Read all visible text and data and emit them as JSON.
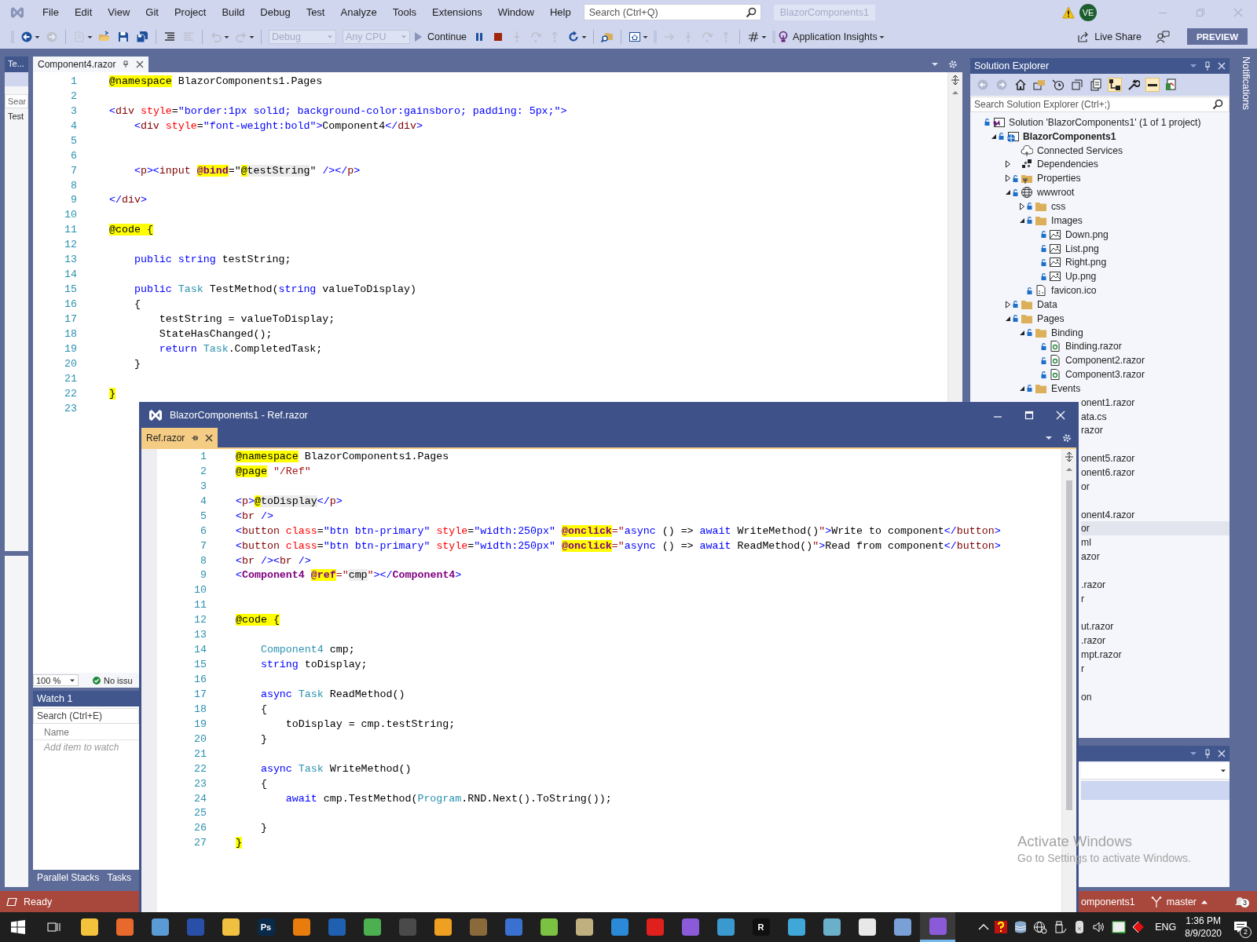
{
  "menu": [
    "File",
    "Edit",
    "View",
    "Git",
    "Project",
    "Build",
    "Debug",
    "Test",
    "Analyze",
    "Tools",
    "Extensions",
    "Window",
    "Help"
  ],
  "search": {
    "placeholder": "Search (Ctrl+Q)"
  },
  "solution_name": "BlazorComponents1",
  "account": {
    "initials": "VE"
  },
  "toolbar": [
    {
      "kind": "grip"
    },
    {
      "kind": "back",
      "disabled": false
    },
    {
      "kind": "caret",
      "disabled": false
    },
    {
      "kind": "forward",
      "disabled": true
    },
    {
      "kind": "sep"
    },
    {
      "kind": "new",
      "disabled": true
    },
    {
      "kind": "caret",
      "disabled": false
    },
    {
      "kind": "open",
      "disabled": false
    },
    {
      "kind": "save",
      "disabled": false
    },
    {
      "kind": "saveall",
      "disabled": false
    },
    {
      "kind": "sep"
    },
    {
      "kind": "comment",
      "disabled": false
    },
    {
      "kind": "uncomment",
      "disabled": true
    },
    {
      "kind": "sep"
    },
    {
      "kind": "undo",
      "disabled": true
    },
    {
      "kind": "caret",
      "disabled": false
    },
    {
      "kind": "redo",
      "disabled": true
    },
    {
      "kind": "caret",
      "disabled": false
    },
    {
      "kind": "sep"
    },
    {
      "kind": "combo",
      "label": "Debug",
      "disabled": true
    },
    {
      "kind": "combo",
      "label": "Any CPU",
      "disabled": true
    },
    {
      "kind": "continue",
      "label": "Continue",
      "disabled": false
    },
    {
      "kind": "pause",
      "disabled": false
    },
    {
      "kind": "stop",
      "disabled": false
    },
    {
      "kind": "stepinto",
      "disabled": true
    },
    {
      "kind": "stepover",
      "disabled": true
    },
    {
      "kind": "stepout",
      "disabled": true
    },
    {
      "kind": "restart",
      "disabled": false
    },
    {
      "kind": "caret",
      "disabled": false
    },
    {
      "kind": "sep"
    },
    {
      "kind": "find",
      "disabled": false
    },
    {
      "kind": "sep"
    },
    {
      "kind": "screen",
      "disabled": false
    },
    {
      "kind": "caret",
      "disabled": false
    },
    {
      "kind": "grip"
    },
    {
      "kind": "forward_arrow",
      "disabled": true
    },
    {
      "kind": "stepinto",
      "disabled": true
    },
    {
      "kind": "stepover",
      "disabled": true
    },
    {
      "kind": "stepout",
      "disabled": true
    },
    {
      "kind": "sep"
    },
    {
      "kind": "hash",
      "disabled": false
    },
    {
      "kind": "caret",
      "disabled": false
    },
    {
      "kind": "grip"
    },
    {
      "kind": "insights",
      "label": "Application Insights",
      "disabled": false
    },
    {
      "kind": "caret",
      "disabled": false
    }
  ],
  "live_share": "Live Share",
  "preview": "PREVIEW",
  "left_panel": {
    "tab": "Te...",
    "search": "Sear",
    "item": "Test"
  },
  "editor": {
    "tab": {
      "label": "Component4.razor",
      "selected": true
    },
    "zoom": "100 %",
    "issues": "No issu",
    "lines": [
      {
        "n": "1",
        "tokens": [
          {
            "kind": "dir",
            "text": "@namespace"
          },
          {
            "kind": "p",
            "text": " BlazorComponents1.Pages"
          }
        ]
      },
      {
        "n": "2"
      },
      {
        "n": "3",
        "tokens": [
          {
            "kind": "tagd",
            "text": "<"
          },
          {
            "kind": "tagn",
            "text": "div"
          },
          {
            "kind": "attr",
            "text": " style"
          },
          {
            "kind": "p",
            "text": "="
          },
          {
            "kind": "val",
            "text": "\"border:1px solid; background-color:gainsboro; padding: 5px;\""
          },
          {
            "kind": "tagd",
            "text": ">"
          }
        ]
      },
      {
        "n": "4",
        "tokens": [
          {
            "kind": "tagd",
            "text": "    <"
          },
          {
            "kind": "tagn",
            "text": "div"
          },
          {
            "kind": "attr",
            "text": " style"
          },
          {
            "kind": "p",
            "text": "="
          },
          {
            "kind": "val",
            "text": "\"font-weight:bold\""
          },
          {
            "kind": "tagd",
            "text": ">"
          },
          {
            "kind": "p",
            "text": "Component4"
          },
          {
            "kind": "tagd",
            "text": "</"
          },
          {
            "kind": "tagn",
            "text": "div"
          },
          {
            "kind": "tagd",
            "text": ">"
          }
        ]
      },
      {
        "n": "5"
      },
      {
        "n": "6"
      },
      {
        "n": "7",
        "tokens": [
          {
            "kind": "tagd",
            "text": "    <"
          },
          {
            "kind": "tagn",
            "text": "p"
          },
          {
            "kind": "tagd",
            "text": "><"
          },
          {
            "kind": "tagn",
            "text": "input "
          },
          {
            "kind": "rattr",
            "text": "@bind"
          },
          {
            "kind": "p",
            "text": "=\""
          },
          {
            "kind": "dir",
            "text": "@"
          },
          {
            "kind": "cs",
            "text": "testString"
          },
          {
            "kind": "p",
            "text": "\" "
          },
          {
            "kind": "tagd",
            "text": "/></"
          },
          {
            "kind": "tagn",
            "text": "p"
          },
          {
            "kind": "tagd",
            "text": ">"
          }
        ]
      },
      {
        "n": "8"
      },
      {
        "n": "9",
        "tokens": [
          {
            "kind": "tagd",
            "text": "</"
          },
          {
            "kind": "tagn",
            "text": "div"
          },
          {
            "kind": "tagd",
            "text": ">"
          }
        ]
      },
      {
        "n": "10"
      },
      {
        "n": "11",
        "tokens": [
          {
            "kind": "dir",
            "text": "@code"
          },
          {
            "kind": "dir",
            "text": " {"
          }
        ]
      },
      {
        "n": "12"
      },
      {
        "n": "13",
        "tokens": [
          {
            "kind": "kw",
            "text": "    public"
          },
          {
            "kind": "kw",
            "text": " string"
          },
          {
            "kind": "p",
            "text": " testString;"
          }
        ]
      },
      {
        "n": "14"
      },
      {
        "n": "15",
        "tokens": [
          {
            "kind": "kw",
            "text": "    public"
          },
          {
            "kind": "type",
            "text": " Task"
          },
          {
            "kind": "p",
            "text": " TestMethod("
          },
          {
            "kind": "kw",
            "text": "string"
          },
          {
            "kind": "p",
            "text": " valueToDisplay)"
          }
        ]
      },
      {
        "n": "16",
        "tokens": [
          {
            "kind": "p",
            "text": "    {"
          }
        ]
      },
      {
        "n": "17",
        "tokens": [
          {
            "kind": "p",
            "text": "        testString = valueToDisplay;"
          }
        ]
      },
      {
        "n": "18",
        "tokens": [
          {
            "kind": "p",
            "text": "        StateHasChanged();"
          }
        ]
      },
      {
        "n": "19",
        "tokens": [
          {
            "kind": "kw",
            "text": "        return"
          },
          {
            "kind": "type",
            "text": " Task"
          },
          {
            "kind": "p",
            "text": ".CompletedTask;"
          }
        ]
      },
      {
        "n": "20",
        "tokens": [
          {
            "kind": "p",
            "text": "    }"
          }
        ]
      },
      {
        "n": "21"
      },
      {
        "n": "22",
        "tokens": [
          {
            "kind": "dir",
            "text": "}"
          }
        ]
      },
      {
        "n": "23"
      }
    ]
  },
  "watch": {
    "title": "Watch 1",
    "search_placeholder": "Search (Ctrl+E)",
    "column": "Name",
    "hint": "Add item to watch",
    "tabs": [
      {
        "label": "Parallel Stacks",
        "selected": false
      },
      {
        "label": "Tasks",
        "selected": false
      }
    ]
  },
  "solution_explorer": {
    "title": "Solution Explorer",
    "search_placeholder": "Search Solution Explorer (Ctrl+;)",
    "tree": [
      {
        "label": "Solution 'BlazorComponents1' (1 of 1 project)",
        "kind": "solution",
        "locked": true,
        "children": [
          {
            "label": "BlazorComponents1",
            "kind": "project",
            "locked": true,
            "expanded": true,
            "children": [
              {
                "label": "Connected Services",
                "kind": "service",
                "locked": false
              },
              {
                "label": "Dependencies",
                "kind": "deps",
                "locked": false,
                "expanded": false
              },
              {
                "label": "Properties",
                "kind": "props",
                "locked": true,
                "expanded": false
              },
              {
                "label": "wwwroot",
                "kind": "globe",
                "locked": true,
                "expanded": true,
                "children": [
                  {
                    "label": "css",
                    "kind": "folder",
                    "locked": true,
                    "expanded": false
                  },
                  {
                    "label": "Images",
                    "kind": "folder",
                    "locked": true,
                    "expanded": true,
                    "children": [
                      {
                        "label": "Down.png",
                        "kind": "image",
                        "locked": true
                      },
                      {
                        "label": "List.png",
                        "kind": "image",
                        "locked": true
                      },
                      {
                        "label": "Right.png",
                        "kind": "image",
                        "locked": true
                      },
                      {
                        "label": "Up.png",
                        "kind": "image",
                        "locked": true
                      }
                    ]
                  },
                  {
                    "label": "favicon.ico",
                    "kind": "file",
                    "locked": true
                  }
                ]
              },
              {
                "label": "Data",
                "kind": "folder",
                "locked": true,
                "expanded": false
              },
              {
                "label": "Pages",
                "kind": "folder",
                "locked": true,
                "expanded": true,
                "children": [
                  {
                    "label": "Binding",
                    "kind": "folder",
                    "locked": true,
                    "expanded": true,
                    "children": [
                      {
                        "label": "Binding.razor",
                        "kind": "razor",
                        "locked": true
                      },
                      {
                        "label": "Component2.razor",
                        "kind": "razor",
                        "locked": true
                      },
                      {
                        "label": "Component3.razor",
                        "kind": "razor",
                        "locked": true
                      }
                    ]
                  },
                  {
                    "label": "Events",
                    "kind": "folder",
                    "locked": true,
                    "expanded": true
                  }
                ]
              }
            ]
          }
        ]
      }
    ],
    "covered_rows": [
      {
        "text": "onent1.razor",
        "selected": false
      },
      {
        "text": "ata.cs",
        "selected": false
      },
      {
        "text": "razor",
        "selected": false
      },
      {
        "selected": false
      },
      {
        "text": "onent5.razor",
        "selected": false
      },
      {
        "text": "onent6.razor",
        "selected": false
      },
      {
        "text": "or",
        "selected": false
      },
      {
        "selected": false
      },
      {
        "text": "onent4.razor",
        "selected": false
      },
      {
        "text": "or",
        "selected": true
      },
      {
        "text": "ml",
        "selected": false
      },
      {
        "text": "azor",
        "selected": false
      },
      {
        "selected": false
      },
      {
        "text": ".razor",
        "selected": false
      },
      {
        "text": "r",
        "selected": false
      },
      {
        "selected": false
      },
      {
        "text": "ut.razor",
        "selected": false
      },
      {
        "text": ".razor",
        "selected": false
      },
      {
        "text": "mpt.razor",
        "selected": false
      },
      {
        "text": "r",
        "selected": false
      },
      {
        "selected": false
      },
      {
        "text": "on",
        "selected": false
      }
    ]
  },
  "lower_panel": {
    "rows": [
      {
        "selected": true
      }
    ]
  },
  "notifications_tab": "Notifications",
  "floating_window": {
    "title": "BlazorComponents1 - Ref.razor",
    "tab": {
      "label": "Ref.razor",
      "selected": true
    },
    "lines": [
      {
        "n": "1",
        "tokens": [
          {
            "kind": "dir",
            "text": "@namespace"
          },
          {
            "kind": "p",
            "text": " BlazorComponents1.Pages"
          }
        ]
      },
      {
        "n": "2",
        "tokens": [
          {
            "kind": "dir",
            "text": "@page"
          },
          {
            "kind": "str",
            "text": " \"/Ref\""
          }
        ]
      },
      {
        "n": "3"
      },
      {
        "n": "4",
        "tokens": [
          {
            "kind": "tagd",
            "text": "<"
          },
          {
            "kind": "tagn",
            "text": "p"
          },
          {
            "kind": "tagd",
            "text": ">"
          },
          {
            "kind": "dir",
            "text": "@"
          },
          {
            "kind": "cs",
            "text": "toDisplay"
          },
          {
            "kind": "tagd",
            "text": "</"
          },
          {
            "kind": "tagn",
            "text": "p"
          },
          {
            "kind": "tagd",
            "text": ">"
          }
        ]
      },
      {
        "n": "5",
        "tokens": [
          {
            "kind": "tagd",
            "text": "<"
          },
          {
            "kind": "tagn",
            "text": "br"
          },
          {
            "kind": "tagd",
            "text": " />"
          }
        ]
      },
      {
        "n": "6",
        "tokens": [
          {
            "kind": "tagd",
            "text": "<"
          },
          {
            "kind": "tagn",
            "text": "button"
          },
          {
            "kind": "attr",
            "text": " class"
          },
          {
            "kind": "p",
            "text": "="
          },
          {
            "kind": "val",
            "text": "\"btn btn-primary\""
          },
          {
            "kind": "attr",
            "text": " style"
          },
          {
            "kind": "p",
            "text": "="
          },
          {
            "kind": "val",
            "text": "\"width:250px\" "
          },
          {
            "kind": "rattr",
            "text": "@onclick"
          },
          {
            "kind": "str",
            "text": "=\""
          },
          {
            "kind": "kw",
            "text": "async"
          },
          {
            "kind": "p",
            "text": " () => "
          },
          {
            "kind": "kw",
            "text": "await"
          },
          {
            "kind": "p",
            "text": " WriteMethod()"
          },
          {
            "kind": "str",
            "text": "\""
          },
          {
            "kind": "tagd",
            "text": ">"
          },
          {
            "kind": "p",
            "text": "Write to component"
          },
          {
            "kind": "tagd",
            "text": "</"
          },
          {
            "kind": "tagn",
            "text": "button"
          },
          {
            "kind": "tagd",
            "text": ">"
          }
        ]
      },
      {
        "n": "7",
        "tokens": [
          {
            "kind": "tagd",
            "text": "<"
          },
          {
            "kind": "tagn",
            "text": "button"
          },
          {
            "kind": "attr",
            "text": " class"
          },
          {
            "kind": "p",
            "text": "="
          },
          {
            "kind": "val",
            "text": "\"btn btn-primary\""
          },
          {
            "kind": "attr",
            "text": " style"
          },
          {
            "kind": "p",
            "text": "="
          },
          {
            "kind": "val",
            "text": "\"width:250px\" "
          },
          {
            "kind": "rattr",
            "text": "@onclick"
          },
          {
            "kind": "str",
            "text": "=\""
          },
          {
            "kind": "kw",
            "text": "async"
          },
          {
            "kind": "p",
            "text": " () => "
          },
          {
            "kind": "kw",
            "text": "await"
          },
          {
            "kind": "p",
            "text": " ReadMethod()"
          },
          {
            "kind": "str",
            "text": "\""
          },
          {
            "kind": "tagd",
            "text": ">"
          },
          {
            "kind": "p",
            "text": "Read from component"
          },
          {
            "kind": "tagd",
            "text": "</"
          },
          {
            "kind": "tagn",
            "text": "button"
          },
          {
            "kind": "tagd",
            "text": ">"
          }
        ]
      },
      {
        "n": "8",
        "tokens": [
          {
            "kind": "tagd",
            "text": "<"
          },
          {
            "kind": "tagn",
            "text": "br"
          },
          {
            "kind": "tagd",
            "text": " /><"
          },
          {
            "kind": "tagn",
            "text": "br"
          },
          {
            "kind": "tagd",
            "text": " />"
          }
        ]
      },
      {
        "n": "9",
        "tokens": [
          {
            "kind": "tagd",
            "text": "<"
          },
          {
            "kind": "comp",
            "text": "Component4 "
          },
          {
            "kind": "rattr",
            "text": "@ref"
          },
          {
            "kind": "str",
            "text": "=\""
          },
          {
            "kind": "cs",
            "text": "cmp"
          },
          {
            "kind": "str",
            "text": "\""
          },
          {
            "kind": "tagd",
            "text": "></"
          },
          {
            "kind": "comp",
            "text": "Component4"
          },
          {
            "kind": "tagd",
            "text": ">"
          }
        ]
      },
      {
        "n": "10"
      },
      {
        "n": "11"
      },
      {
        "n": "12",
        "tokens": [
          {
            "kind": "dir",
            "text": "@code"
          },
          {
            "kind": "dir",
            "text": " {"
          }
        ]
      },
      {
        "n": "13"
      },
      {
        "n": "14",
        "tokens": [
          {
            "kind": "type",
            "text": "    Component4"
          },
          {
            "kind": "p",
            "text": " cmp;"
          }
        ]
      },
      {
        "n": "15",
        "tokens": [
          {
            "kind": "kw",
            "text": "    string"
          },
          {
            "kind": "p",
            "text": " toDisplay;"
          }
        ]
      },
      {
        "n": "16"
      },
      {
        "n": "17",
        "tokens": [
          {
            "kind": "kw",
            "text": "    async"
          },
          {
            "kind": "type",
            "text": " Task"
          },
          {
            "kind": "p",
            "text": " ReadMethod()"
          }
        ]
      },
      {
        "n": "18",
        "tokens": [
          {
            "kind": "p",
            "text": "    {"
          }
        ]
      },
      {
        "n": "19",
        "tokens": [
          {
            "kind": "p",
            "text": "        toDisplay = cmp.testString;"
          }
        ]
      },
      {
        "n": "20",
        "tokens": [
          {
            "kind": "p",
            "text": "    }"
          }
        ]
      },
      {
        "n": "21"
      },
      {
        "n": "22",
        "tokens": [
          {
            "kind": "kw",
            "text": "    async"
          },
          {
            "kind": "type",
            "text": " Task"
          },
          {
            "kind": "p",
            "text": " WriteMethod()"
          }
        ]
      },
      {
        "n": "23",
        "tokens": [
          {
            "kind": "p",
            "text": "    {"
          }
        ]
      },
      {
        "n": "24",
        "tokens": [
          {
            "kind": "kw",
            "text": "        await"
          },
          {
            "kind": "p",
            "text": " cmp.TestMethod("
          },
          {
            "kind": "type",
            "text": "Program"
          },
          {
            "kind": "p",
            "text": ".RND.Next().ToString());"
          }
        ]
      },
      {
        "n": "25"
      },
      {
        "n": "26",
        "tokens": [
          {
            "kind": "p",
            "text": "    }"
          }
        ]
      },
      {
        "n": "27",
        "tokens": [
          {
            "kind": "dir",
            "text": "}"
          }
        ]
      }
    ]
  },
  "status_bar": {
    "text": "Ready",
    "project": "omponents1",
    "branch": "master",
    "notifications": "3"
  },
  "os_notice": {
    "title": "Activate Windows",
    "text": "Go to Settings to activate Windows."
  },
  "taskbar": {
    "apps": [
      {
        "color": "#f3c33c",
        "selected": false
      },
      {
        "color": "#e8692c",
        "selected": false
      },
      {
        "color": "#5a9bd5",
        "selected": false
      },
      {
        "color": "#2a4fa8",
        "selected": false
      },
      {
        "color": "#f0c040",
        "selected": false
      },
      {
        "color": "#0a2a4a",
        "label": "Ps",
        "selected": false
      },
      {
        "color": "#e87d0d",
        "selected": false
      },
      {
        "color": "#2060b0",
        "selected": false
      },
      {
        "color": "#4caf50",
        "selected": false
      },
      {
        "color": "#4a4a4a",
        "selected": false
      },
      {
        "color": "#f0a020",
        "selected": false
      },
      {
        "color": "#8a6a3a",
        "selected": false
      },
      {
        "color": "#3a70d0",
        "selected": false
      },
      {
        "color": "#7cc242",
        "selected": false
      },
      {
        "color": "#c0b080",
        "selected": false
      },
      {
        "color": "#2a8ad8",
        "selected": false
      },
      {
        "color": "#e0201c",
        "selected": false
      },
      {
        "color": "#8a5ad8",
        "selected": false
      },
      {
        "color": "#3a9ad0",
        "selected": false
      },
      {
        "color": "#101010",
        "label": "R",
        "selected": false
      },
      {
        "color": "#40a8d8",
        "selected": false
      },
      {
        "color": "#6ab0c8",
        "selected": false
      },
      {
        "color": "#e8e8e8",
        "selected": false
      },
      {
        "color": "#7aa0d8",
        "selected": false
      },
      {
        "color": "#8a5ad8",
        "selected": true
      }
    ],
    "language": "ENG",
    "time": "1:36 PM",
    "date": "8/9/2020",
    "notifications": "2"
  }
}
